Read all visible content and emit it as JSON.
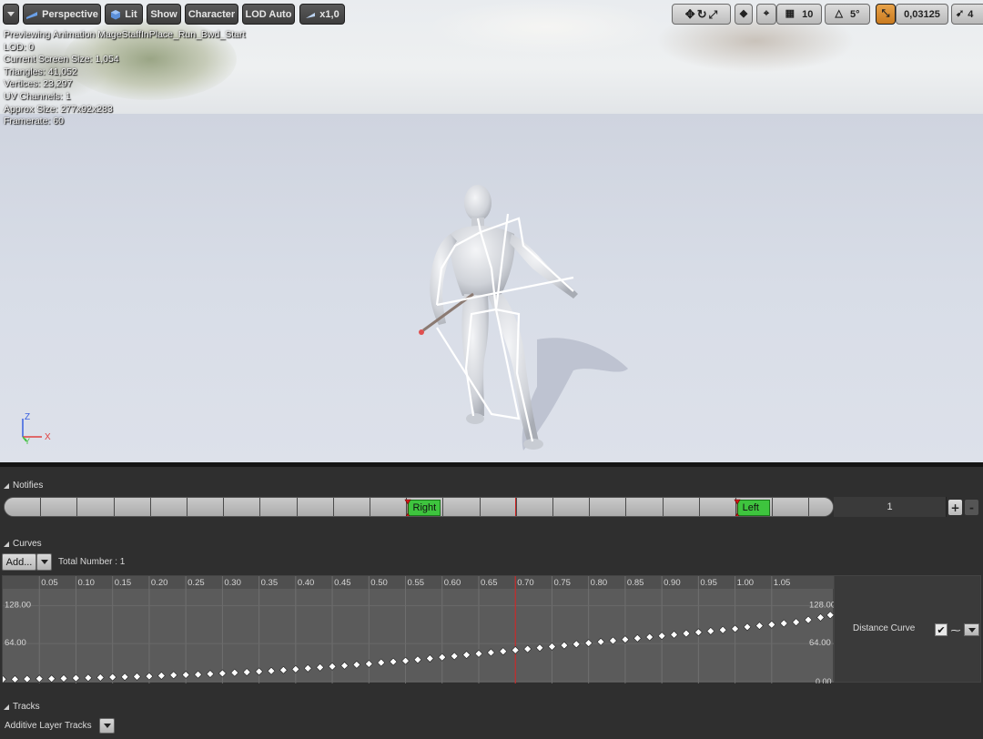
{
  "toolbar": {
    "menu_icon": "chevron-down-icon",
    "perspective_label": "Perspective",
    "lit_label": "Lit",
    "show_label": "Show",
    "character_label": "Character",
    "lod_label": "LOD Auto",
    "speed_label": "x1,0",
    "grid_size": "10",
    "rotation_snap": "5°",
    "scale_snap": "0,03125",
    "camera_speed": "4",
    "accent_color": "#e0962f"
  },
  "stats": {
    "line1": "Previewing Animation MageStaffInPlace_Run_Bwd_Start",
    "line2": "LOD: 0",
    "line3": "Current Screen Size: 1,054",
    "line4": "Triangles: 41,052",
    "line5": "Vertices: 23,297",
    "line6": "UV Channels: 1",
    "line7": "Approx Size: 277x92x283",
    "line8": "Framerate: 60"
  },
  "axes": {
    "z": "Z",
    "x": "X",
    "y": "Y"
  },
  "notifies": {
    "header": "Notifies",
    "items": [
      {
        "label": "Right",
        "time": 0.55
      },
      {
        "label": "Left",
        "time": 1.0
      }
    ],
    "track_number": "1",
    "add_symbol": "+",
    "remove_symbol": "-"
  },
  "curves": {
    "header": "Curves",
    "add_label": "Add...",
    "total_number": "Total Number : 1",
    "curve_name": "Distance Curve",
    "checked": true,
    "y_labels": {
      "top": "128.00",
      "mid": "64.00",
      "bottom": "0.00"
    },
    "playhead_time": 0.7
  },
  "tracks": {
    "header": "Tracks",
    "additive_label": "Additive Layer Tracks"
  },
  "chart_data": {
    "type": "scatter",
    "x_ticks": [
      "0.05",
      "0.10",
      "0.15",
      "0.20",
      "0.25",
      "0.30",
      "0.35",
      "0.40",
      "0.45",
      "0.50",
      "0.55",
      "0.60",
      "0.65",
      "0.70",
      "0.75",
      "0.80",
      "0.85",
      "0.90",
      "0.95",
      "1.00",
      "1.05"
    ],
    "xlim": [
      0,
      1.13
    ],
    "ylim": [
      0,
      150
    ],
    "series": [
      {
        "name": "Distance Curve",
        "x": [
          0.0,
          0.0167,
          0.0333,
          0.05,
          0.0667,
          0.0833,
          0.1,
          0.1167,
          0.1333,
          0.15,
          0.1667,
          0.1833,
          0.2,
          0.2167,
          0.2333,
          0.25,
          0.2667,
          0.2833,
          0.3,
          0.3167,
          0.3333,
          0.35,
          0.3667,
          0.3833,
          0.4,
          0.4167,
          0.4333,
          0.45,
          0.4667,
          0.4833,
          0.5,
          0.5167,
          0.5333,
          0.55,
          0.5667,
          0.5833,
          0.6,
          0.6167,
          0.6333,
          0.65,
          0.6667,
          0.6833,
          0.7,
          0.7167,
          0.7333,
          0.75,
          0.7667,
          0.7833,
          0.8,
          0.8167,
          0.8333,
          0.85,
          0.8667,
          0.8833,
          0.9,
          0.9167,
          0.9333,
          0.95,
          0.9667,
          0.9833,
          1.0,
          1.0167,
          1.0333,
          1.05,
          1.0667,
          1.0833,
          1.1,
          1.1167,
          1.13
        ],
        "y": [
          4,
          4,
          4.5,
          5,
          5,
          5.5,
          6,
          6.5,
          7,
          7.5,
          8,
          8.5,
          9,
          10,
          11,
          11.5,
          12,
          13,
          14,
          15,
          16,
          17,
          18,
          19.5,
          21,
          22.5,
          24,
          25.5,
          27,
          28.5,
          30,
          32,
          33.5,
          35,
          37,
          39,
          41,
          43,
          45,
          47,
          49,
          51,
          53,
          55,
          57,
          59,
          61,
          63,
          65,
          67,
          69,
          71,
          73,
          75,
          77,
          79,
          81,
          83,
          85,
          87,
          89,
          92,
          94,
          96,
          98,
          100,
          104,
          108,
          112
        ]
      }
    ]
  }
}
